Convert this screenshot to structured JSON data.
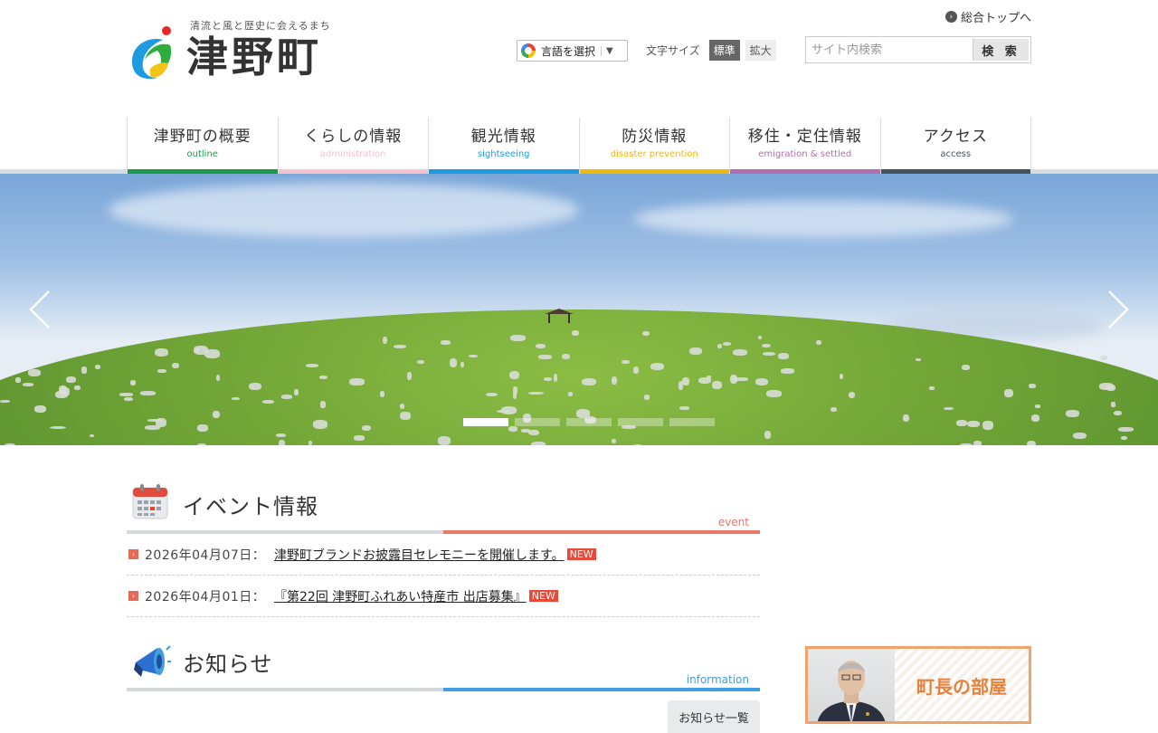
{
  "header": {
    "tagline": "清流と風と歴史に会えるまち",
    "site_name": "津野町",
    "top_link": "総合トップへ",
    "translate_label": "言語を選択",
    "translate_arrow": "▼",
    "font_size_label": "文字サイズ",
    "font_size_options": [
      "標準",
      "拡大"
    ],
    "search_placeholder": "サイト内検索",
    "search_button": "検 索"
  },
  "nav": [
    {
      "label": "津野町の概要",
      "sub": "outline",
      "color": "#1b9a4b"
    },
    {
      "label": "くらしの情報",
      "sub": "administration",
      "color": "#f6c3cc"
    },
    {
      "label": "観光情報",
      "sub": "sightseeing",
      "color": "#1e9be0"
    },
    {
      "label": "防災情報",
      "sub": "disaster prevention",
      "color": "#f2b80e"
    },
    {
      "label": "移住・定住情報",
      "sub": "emigration & settled",
      "color": "#b06fb0"
    },
    {
      "label": "アクセス",
      "sub": "access",
      "color": "#45525c"
    }
  ],
  "hero": {
    "prev_icon": "chevron-left-icon",
    "next_icon": "chevron-right-icon",
    "slide_count": 5,
    "active_slide": 1
  },
  "events": {
    "title": "イベント情報",
    "sub": "event",
    "accent": "#e8786a",
    "items": [
      {
        "date": "2026年04月07日：",
        "title": "津野町ブランドお披露目セレモニーを開催します。",
        "badge": "NEW"
      },
      {
        "date": "2026年04月01日：",
        "title": "『第22回 津野町ふれあい特産市 出店募集』",
        "badge": "NEW"
      }
    ]
  },
  "news": {
    "title": "お知らせ",
    "sub": "information",
    "accent": "#3f9de0",
    "list_button": "お知らせ一覧"
  },
  "mayor_banner": {
    "label": "町長の部屋"
  }
}
